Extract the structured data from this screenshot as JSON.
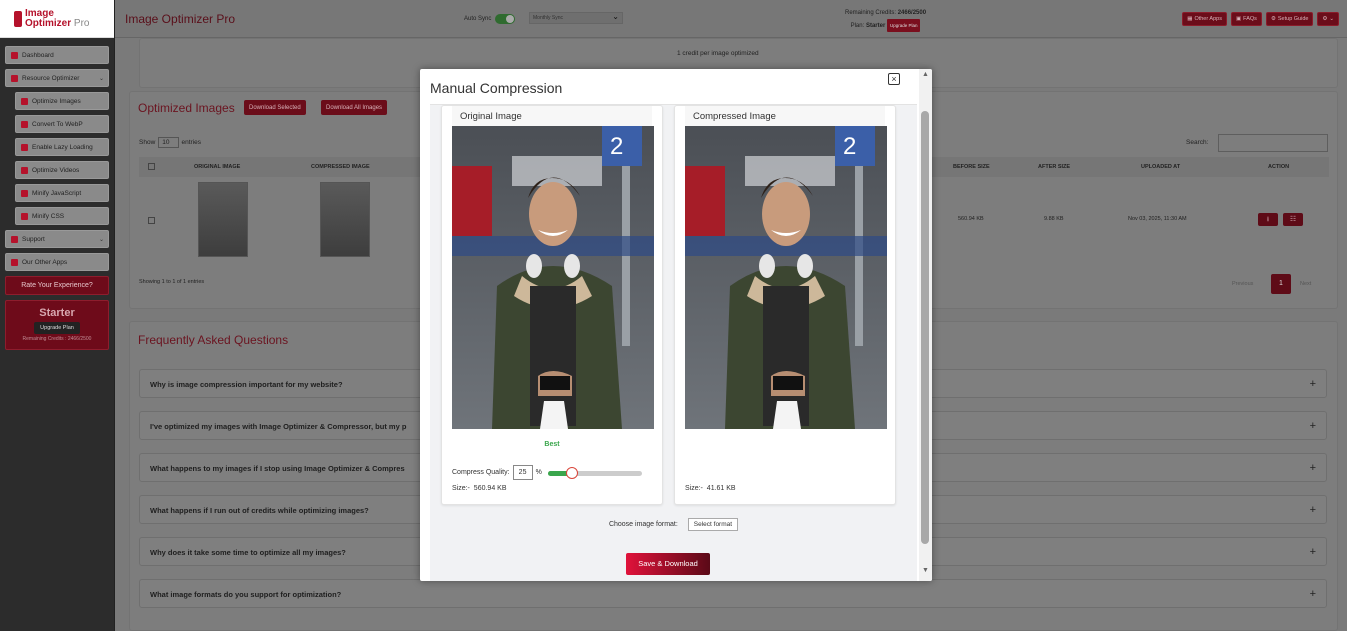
{
  "logo": {
    "line1": "Image",
    "line2": "Optimizer",
    "suffix": "Pro"
  },
  "sidebar": {
    "items": [
      {
        "label": "Dashboard"
      },
      {
        "label": "Resource Optimizer"
      },
      {
        "label": "Optimize Images"
      },
      {
        "label": "Convert To WebP"
      },
      {
        "label": "Enable Lazy Loading"
      },
      {
        "label": "Optimize Videos"
      },
      {
        "label": "Minify JavaScript"
      },
      {
        "label": "Minify CSS"
      },
      {
        "label": "Support"
      },
      {
        "label": "Our Other Apps"
      }
    ],
    "rate_label": "Rate Your Experience?",
    "starter": {
      "title": "Starter",
      "upgrade": "Upgrade Plan",
      "remaining": "Remaining Credits : 2466/2500"
    }
  },
  "header": {
    "title": "Image Optimizer Pro",
    "autosync_label": "Auto Sync",
    "autosync_on": true,
    "sync_select": "Monthly Sync",
    "credits_label": "Remaining Credits:",
    "credits_value": "2466/2500",
    "plan_label": "Plan:",
    "plan_value": "Starter",
    "plan_badge": "Upgrade Plan",
    "buttons": [
      "Other Apps",
      "FAQs",
      "Setup Guide"
    ]
  },
  "banner": {
    "credit_note": "1 credit per image optimized"
  },
  "optimized": {
    "title": "Optimized Images",
    "download_selected": "Download Selected",
    "download_all": "Download All Images",
    "show_label": "Show",
    "entries_value": "10",
    "entries_label": "entries",
    "search_label": "Search:",
    "columns": [
      "ORIGINAL IMAGE",
      "COMPRESSED IMAGE",
      "BEFORE SIZE",
      "AFTER SIZE",
      "UPLOADED AT",
      "ACTION"
    ],
    "row": {
      "before": "560.94 KB",
      "after": "9.88 KB",
      "uploaded": "Nov 03, 2025, 11:30 AM"
    },
    "showing": "Showing 1 to 1 of 1 entries",
    "prev": "Previous",
    "page": "1",
    "next": "Next"
  },
  "faq": {
    "title": "Frequently Asked Questions",
    "items": [
      "Why is image compression important for my website?",
      "I've optimized my images with Image Optimizer & Compressor, but my p",
      "What happens to my images if I stop using Image Optimizer & Compres",
      "What happens if I run out of credits while optimizing images?",
      "Why does it take some time to optimize all my images?",
      "What image formats do you support for optimization?"
    ]
  },
  "modal": {
    "title": "Manual Compression",
    "close": "×",
    "original": {
      "header": "Original Image",
      "quality_badge": "Best",
      "quality_label": "Compress Quality:",
      "quality_value": "25",
      "quality_unit": "%",
      "quality_fraction": 0.25,
      "size_label": "Size:-",
      "size_value": "560.94 KB"
    },
    "compressed": {
      "header": "Compressed Image",
      "size_label": "Size:-",
      "size_value": "41.61 KB"
    },
    "format_label": "Choose image format:",
    "format_select": "Select format",
    "save_label": "Save & Download"
  },
  "colors": {
    "brand": "#b5122b",
    "accent_green": "#3aa64c",
    "save_gradient_start": "#e0123a"
  }
}
